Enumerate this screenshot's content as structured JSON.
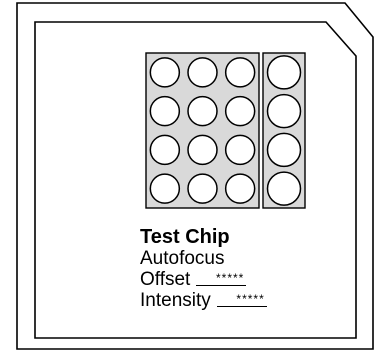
{
  "chip": {
    "title": "Test Chip",
    "subtitle": "Autofocus",
    "offset_label": "Offset",
    "offset_value": "*****",
    "intensity_label": "Intensity",
    "intensity_value": "*****"
  },
  "layout": {
    "well_grid_rows": 4,
    "well_grid_cols": 3,
    "reference_wells": 4
  },
  "colors": {
    "stroke": "#000000",
    "grid_fill": "#d9d9d9",
    "well_fill": "#ffffff",
    "background": "#ffffff"
  }
}
